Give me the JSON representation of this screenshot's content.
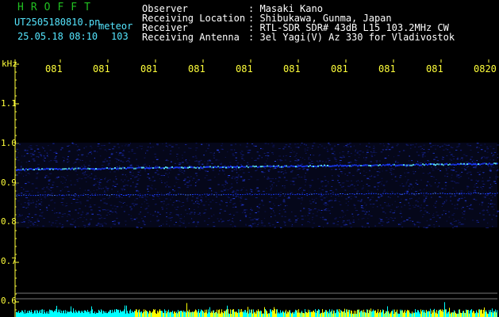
{
  "header": {
    "title": "HROFFT",
    "filename": "UT2505180810.pn",
    "datetime": "25.05.18 08:10",
    "category": "meteor",
    "count": "103",
    "observer_label": "Observer",
    "observer_value": ": Masaki Kano",
    "location_label": "Receiving Location",
    "location_value": ": Shibukawa, Gunma, Japan",
    "receiver_label": "Receiver",
    "receiver_value": ": RTL-SDR SDR# 43dB L15 103.2MHz CW",
    "antenna_label": "Receiving Antenna",
    "antenna_value": ": 3el Yagi(V) Az 330 for Vladivostok"
  },
  "axis": {
    "unit": "kHz",
    "y_ticks": [
      "1.1",
      "1.0",
      "0.9",
      "0.8",
      "0.7",
      "0.6"
    ],
    "x_ticks": [
      "081",
      "081",
      "081",
      "081",
      "081",
      "081",
      "081",
      "081",
      "081",
      "0820"
    ]
  },
  "colors": {
    "background": "#000000",
    "header_green": "#21c021",
    "header_cyan": "#55e6ff",
    "axis_yellow": "#ffff3a",
    "signal_blue": "#1a3cff",
    "signal_cyan": "#5ce8ff",
    "bars_yellow": "#ffff00",
    "bars_cyan": "#00ffff"
  }
}
